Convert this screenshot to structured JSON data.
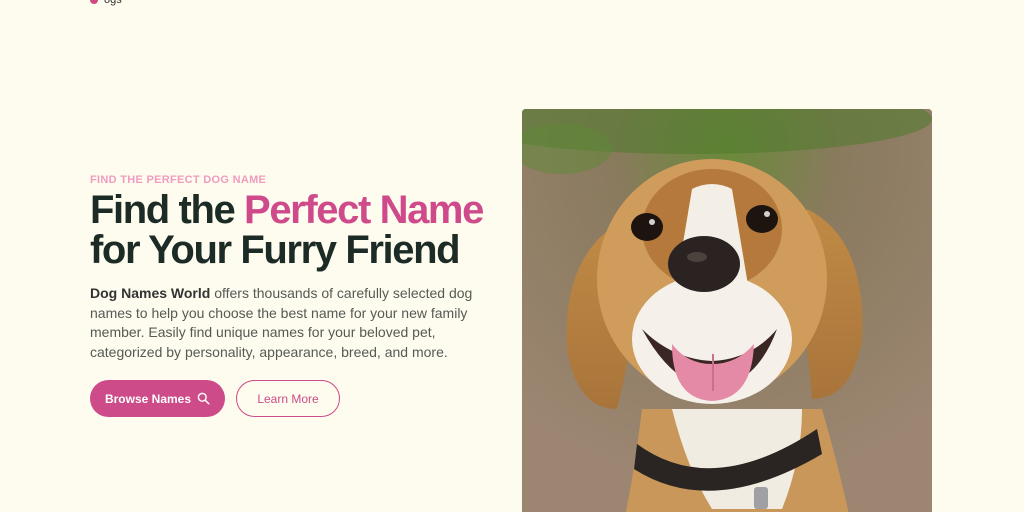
{
  "nav": {
    "logo_text": "g",
    "link_text": "ogs"
  },
  "hero": {
    "eyebrow": "FIND THE PERFECT DOG NAME",
    "headline_part1": "Find the ",
    "headline_accent": "Perfect Name",
    "headline_part2": "for Your Furry Friend",
    "desc_strong": "Dog Names World",
    "desc_rest": " offers thousands of carefully selected dog names to help you choose the best name for your new family member. Easily find unique names for your beloved pet, categorized by personality, appearance, breed, and more.",
    "primary_label": "Browse Names",
    "secondary_label": "Learn More"
  },
  "colors": {
    "background": "#fefcee",
    "accent": "#cc4b88",
    "eyebrow": "#ef9cc0",
    "heading": "#1d2b27"
  },
  "icons": {
    "browse_button_icon": "search-icon",
    "photo": "beagle-dog-photo"
  }
}
